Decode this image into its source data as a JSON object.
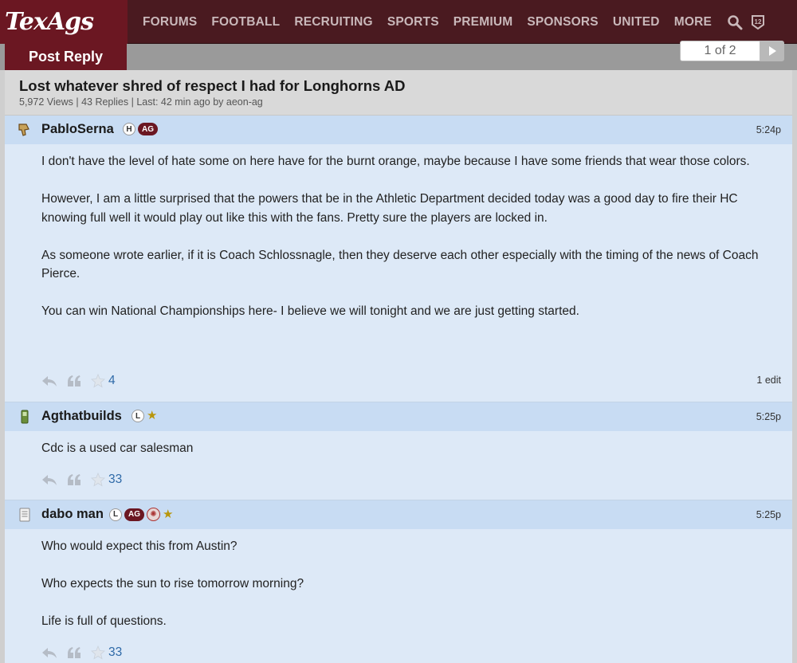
{
  "site": {
    "logo": "TexAgs"
  },
  "nav": {
    "items": [
      "FORUMS",
      "FOOTBALL",
      "RECRUITING",
      "SPORTS",
      "PREMIUM",
      "SPONSORS",
      "UNITED",
      "MORE"
    ],
    "icons": [
      "search-icon",
      "twelve-icon"
    ]
  },
  "actions": {
    "post_reply": "Post Reply"
  },
  "pager": {
    "label": "1 of 2"
  },
  "thread": {
    "title": "Lost whatever shred of respect I had for Longhorns AD",
    "meta": "5,972 Views | 43 Replies | Last: 42 min ago by aeon-ag"
  },
  "colors": {
    "maroon": "#6b1722",
    "nav_bg": "#4a1a20",
    "post_bg": "#dde9f7",
    "post_header_bg": "#c8dcf3",
    "link_blue": "#2f6aa8",
    "star_gold": "#b8960c"
  },
  "posts": [
    {
      "user": "PabloSerna",
      "avatar_icon": "thumbs-down-icon",
      "badges": {
        "letter": "H",
        "ag": "AG"
      },
      "time": "5:24p",
      "paragraphs": [
        "I don't have the level of hate some on here have for the burnt orange, maybe because I have some friends that wear those colors.",
        "However, I am a little surprised that the powers that be in the Athletic Department decided today was a good day to fire their HC knowing full well it would play out like this with the fans. Pretty sure the players are locked in.",
        "As someone wrote earlier, if it is Coach Schlossnagle, then they deserve each other especially with the timing of the news of Coach Pierce.",
        "You can win National Championships here- I believe we will tonight and we are just getting started."
      ],
      "likes": "4",
      "edit_note": "1 edit"
    },
    {
      "user": "Agthatbuilds",
      "avatar_icon": "phone-icon",
      "badges": {
        "letter": "L",
        "star": "★"
      },
      "time": "5:25p",
      "paragraphs": [
        "Cdc is a used car salesman"
      ],
      "likes": "33"
    },
    {
      "user": "dabo man",
      "avatar_icon": "document-icon",
      "badges": {
        "letter": "L",
        "ag": "AG",
        "star": "★"
      },
      "time": "5:25p",
      "paragraphs": [
        "Who would expect this from Austin?",
        "Who expects the sun to rise tomorrow morning?",
        "Life is full of questions."
      ],
      "likes": "33"
    }
  ]
}
